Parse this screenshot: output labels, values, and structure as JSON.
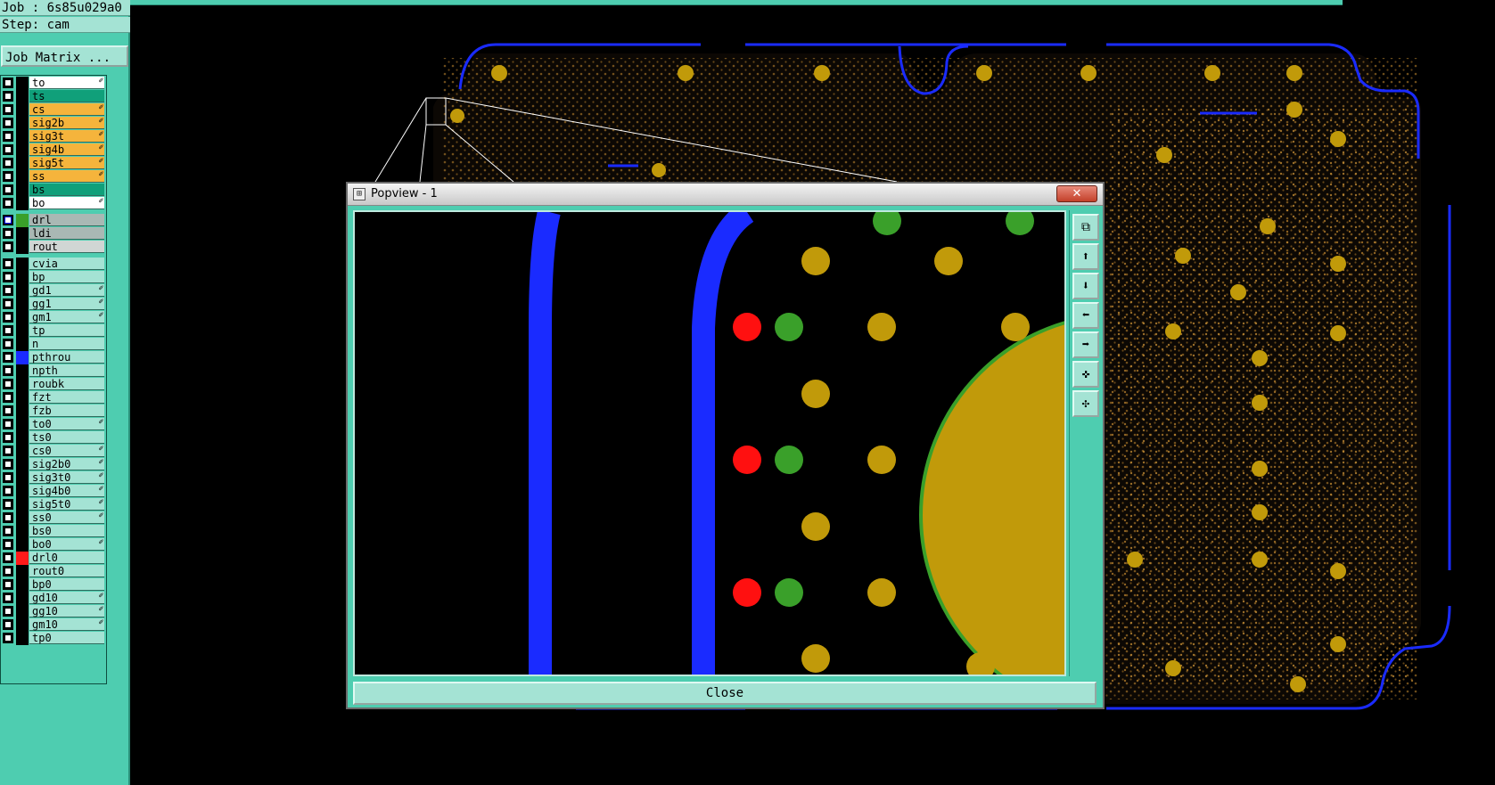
{
  "job_info": {
    "job_line": "Job : 6s85u029a0",
    "step_line": "Step: cam"
  },
  "job_matrix_label": "Job Matrix ...",
  "layers": [
    {
      "name": "to",
      "style": "wht",
      "lock": true,
      "color": null
    },
    {
      "name": "ts",
      "style": "grn",
      "lock": false,
      "color": null
    },
    {
      "name": "cs",
      "style": "ylw",
      "lock": true,
      "color": null
    },
    {
      "name": "sig2b",
      "style": "ylw",
      "lock": true,
      "color": null
    },
    {
      "name": "sig3t",
      "style": "ylw",
      "lock": true,
      "color": null
    },
    {
      "name": "sig4b",
      "style": "ylw",
      "lock": true,
      "color": null
    },
    {
      "name": "sig5t",
      "style": "ylw",
      "lock": true,
      "color": null
    },
    {
      "name": "ss",
      "style": "ylw",
      "lock": true,
      "color": null
    },
    {
      "name": "bs",
      "style": "grn",
      "lock": false,
      "color": null
    },
    {
      "name": "bo",
      "style": "wht",
      "lock": true,
      "color": null
    },
    {
      "name": "drl",
      "style": "gry",
      "lock": false,
      "color": "#3aa02a",
      "selected": true
    },
    {
      "name": "ldi",
      "style": "gry",
      "lock": false,
      "color": null
    },
    {
      "name": "rout",
      "style": "lgry",
      "lock": false,
      "color": null
    },
    {
      "name": "cvia",
      "style": "",
      "lock": false,
      "color": null
    },
    {
      "name": "bp",
      "style": "",
      "lock": false,
      "color": null
    },
    {
      "name": "gd1",
      "style": "",
      "lock": true,
      "color": null
    },
    {
      "name": "gg1",
      "style": "",
      "lock": true,
      "color": null
    },
    {
      "name": "gm1",
      "style": "",
      "lock": true,
      "color": null
    },
    {
      "name": "tp",
      "style": "",
      "lock": false,
      "color": null
    },
    {
      "name": "n",
      "style": "",
      "lock": false,
      "color": null
    },
    {
      "name": "pthrou",
      "style": "",
      "lock": false,
      "color": "#1a2bff"
    },
    {
      "name": "npth",
      "style": "",
      "lock": false,
      "color": null
    },
    {
      "name": "roubk",
      "style": "",
      "lock": false,
      "color": null
    },
    {
      "name": "fzt",
      "style": "",
      "lock": false,
      "color": null
    },
    {
      "name": "fzb",
      "style": "",
      "lock": false,
      "color": null
    },
    {
      "name": "to0",
      "style": "",
      "lock": true,
      "color": null
    },
    {
      "name": "ts0",
      "style": "",
      "lock": false,
      "color": null
    },
    {
      "name": "cs0",
      "style": "",
      "lock": true,
      "color": null
    },
    {
      "name": "sig2b0",
      "style": "",
      "lock": true,
      "color": null
    },
    {
      "name": "sig3t0",
      "style": "",
      "lock": true,
      "color": null
    },
    {
      "name": "sig4b0",
      "style": "",
      "lock": true,
      "color": null
    },
    {
      "name": "sig5t0",
      "style": "",
      "lock": true,
      "color": null
    },
    {
      "name": "ss0",
      "style": "",
      "lock": true,
      "color": null
    },
    {
      "name": "bs0",
      "style": "",
      "lock": false,
      "color": null
    },
    {
      "name": "bo0",
      "style": "",
      "lock": true,
      "color": null
    },
    {
      "name": "drl0",
      "style": "",
      "lock": false,
      "color": "#ff1a1a"
    },
    {
      "name": "rout0",
      "style": "",
      "lock": false,
      "color": null
    },
    {
      "name": "bp0",
      "style": "",
      "lock": false,
      "color": null
    },
    {
      "name": "gd10",
      "style": "",
      "lock": true,
      "color": null
    },
    {
      "name": "gg10",
      "style": "",
      "lock": true,
      "color": null
    },
    {
      "name": "gm10",
      "style": "",
      "lock": true,
      "color": null
    },
    {
      "name": "tp0",
      "style": "",
      "lock": false,
      "color": null
    }
  ],
  "popview": {
    "title": "Popview - 1",
    "close_x": "✕",
    "close_button": "Close",
    "tools": [
      {
        "icon": "zoom-window-icon",
        "glyph": "⧉"
      },
      {
        "icon": "move-up-icon",
        "glyph": "⬆"
      },
      {
        "icon": "move-down-icon",
        "glyph": "⬇"
      },
      {
        "icon": "move-left-icon",
        "glyph": "⬅"
      },
      {
        "icon": "move-right-icon",
        "glyph": "➡"
      },
      {
        "icon": "zoom-in-icon",
        "glyph": "✜"
      },
      {
        "icon": "zoom-out-icon",
        "glyph": "✣"
      }
    ]
  },
  "colors": {
    "panel": "#4ecdb0",
    "panel_light": "#a4e3d4",
    "board_outline": "#1a2bff",
    "pad_gold": "#c19a0a",
    "pad_green": "#3aa02a",
    "pad_red": "#ff1010",
    "dot": "#c58a30"
  }
}
